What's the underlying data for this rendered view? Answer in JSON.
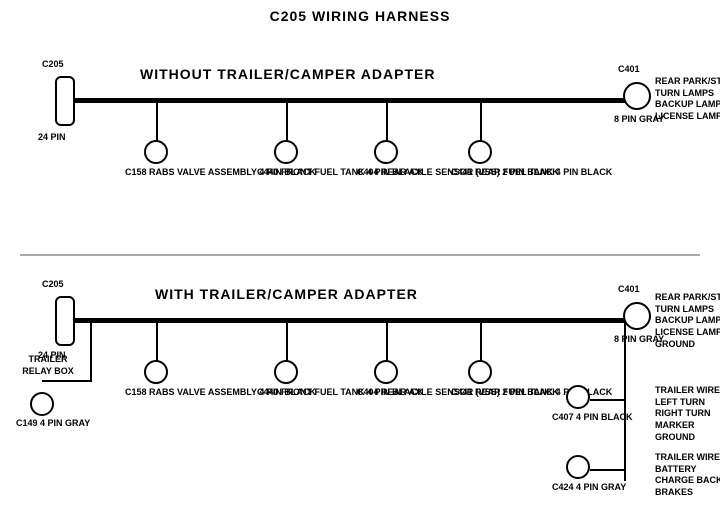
{
  "title": "C205 WIRING HARNESS",
  "section1": {
    "label": "WITHOUT  TRAILER/CAMPER ADAPTER",
    "c205": {
      "label": "C205",
      "pin": "24 PIN"
    },
    "c401": {
      "label": "C401",
      "pin": "8 PIN\nGRAY",
      "desc": "REAR PARK/STOP\nTURN LAMPS\nBACKUP LAMPS\nLICENSE LAMPS"
    },
    "connectors": [
      {
        "id": "C158",
        "label": "C158\nRABS VALVE\nASSEMBLY\n4 PIN BLACK"
      },
      {
        "id": "C440",
        "label": "C440\nFRONT FUEL\nTANK\n4 PIN BLACK"
      },
      {
        "id": "C404",
        "label": "C404\nREAR AXLE\nSENSOR\n(VSS)\n2 PIN BLACK"
      },
      {
        "id": "C441",
        "label": "C441\nREAR FUEL\nTANK\n4 PIN BLACK"
      }
    ]
  },
  "section2": {
    "label": "WITH TRAILER/CAMPER ADAPTER",
    "c205": {
      "label": "C205",
      "pin": "24 PIN"
    },
    "c401": {
      "label": "C401",
      "pin": "8 PIN\nGRAY",
      "desc": "REAR PARK/STOP\nTURN LAMPS\nBACKUP LAMPS\nLICENSE LAMPS\nGROUND"
    },
    "c407": {
      "label": "C407\n4 PIN\nBLACK",
      "desc": "TRAILER WIRES\nLEFT TURN\nRIGHT TURN\nMARKER\nGROUND"
    },
    "c424": {
      "label": "C424\n4 PIN\nGRAY",
      "desc": "TRAILER WIRES\nBATTERY CHARGE\nBACKUP\nBRAKES"
    },
    "trailer": {
      "label": "TRAILER\nRELAY\nBOX"
    },
    "c149": {
      "label": "C149\n4 PIN GRAY"
    },
    "connectors": [
      {
        "id": "C158",
        "label": "C158\nRABS VALVE\nASSEMBLY\n4 PIN BLACK"
      },
      {
        "id": "C440",
        "label": "C440\nFRONT FUEL\nTANK\n4 PIN BLACK"
      },
      {
        "id": "C404",
        "label": "C404\nREAR AXLE\nSENSOR\n(VSS)\n2 PIN BLACK"
      },
      {
        "id": "C441",
        "label": "C441\nREAR FUEL\nTANK\n4 PIN BLACK"
      }
    ]
  }
}
